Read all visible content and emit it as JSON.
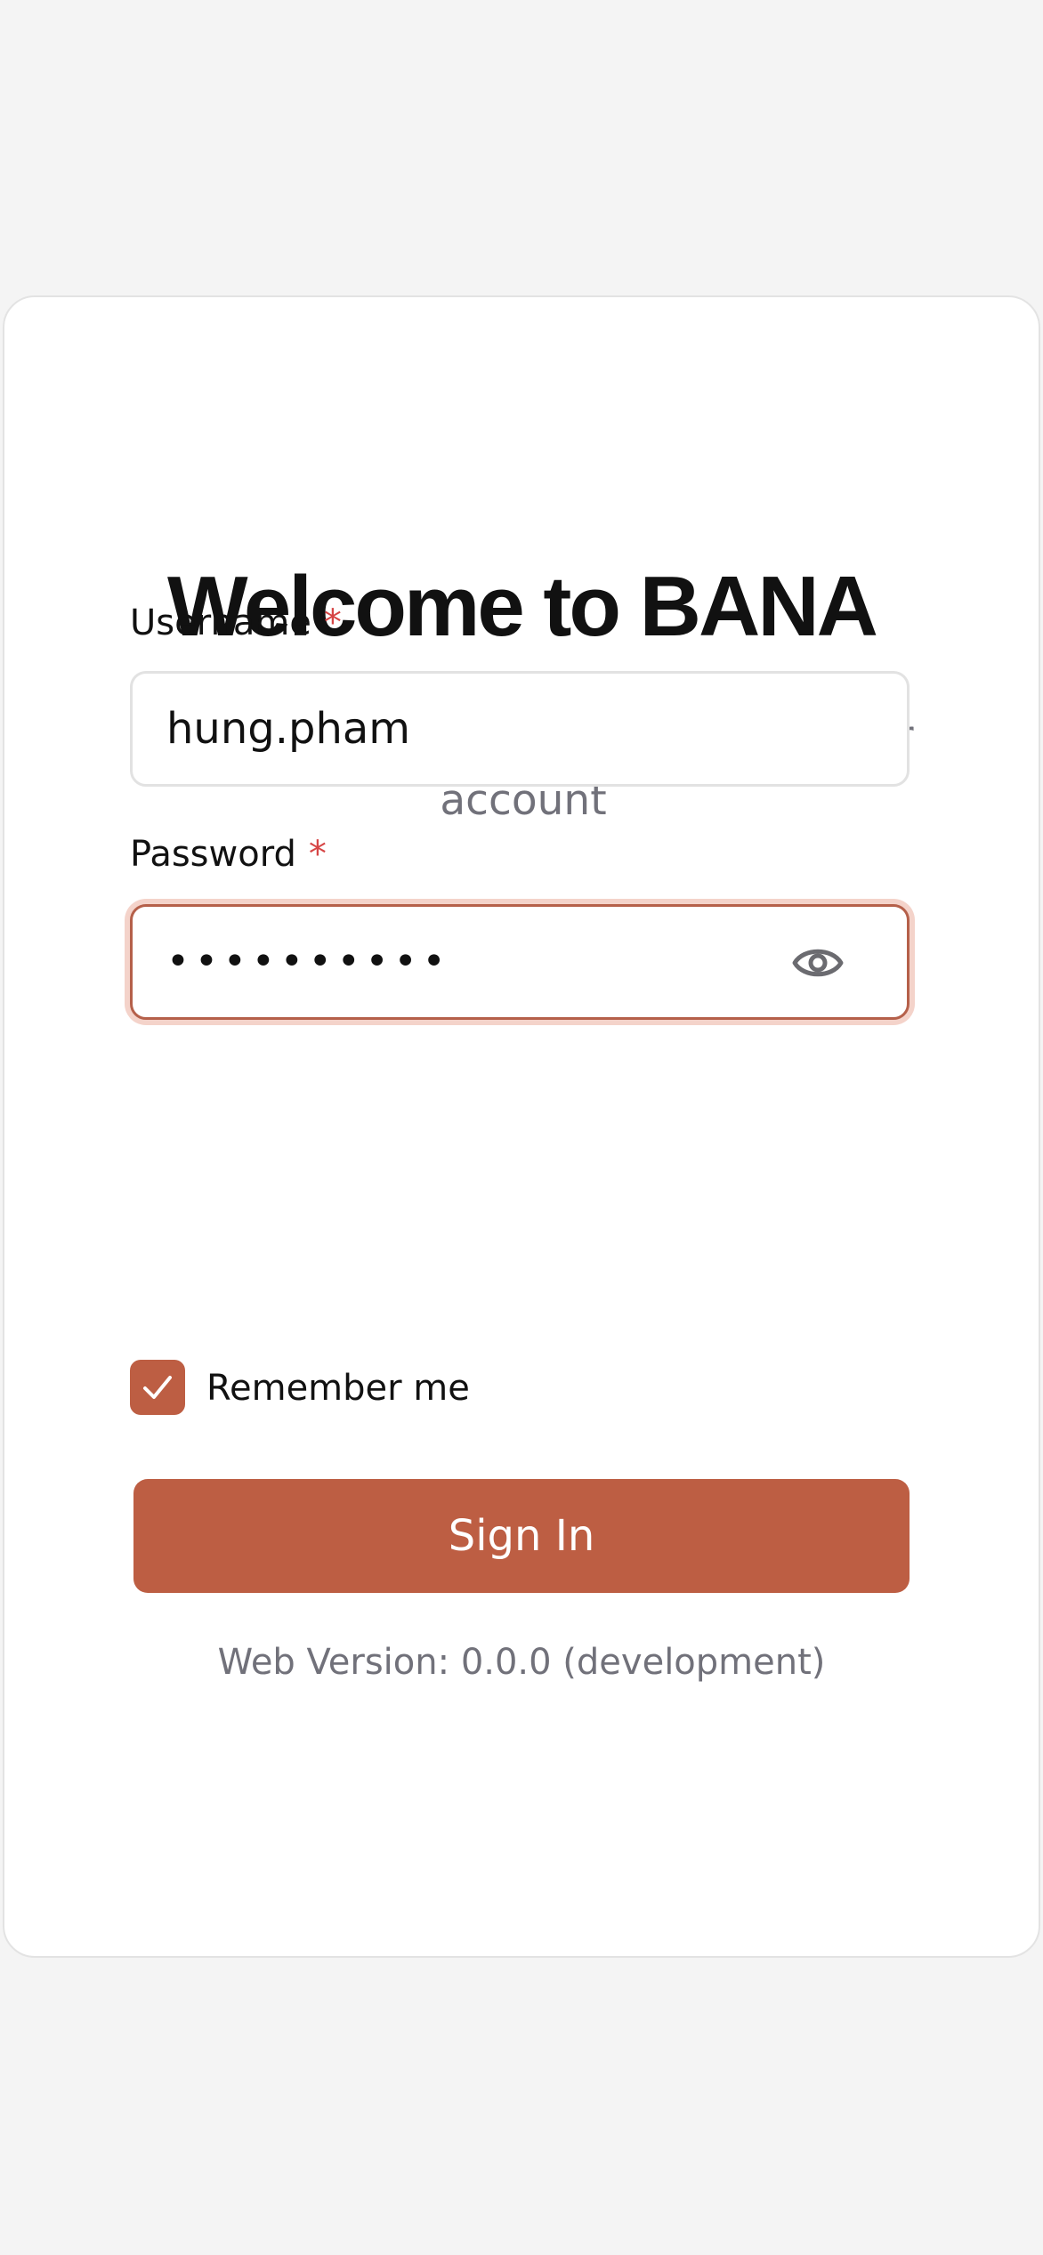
{
  "login": {
    "title": "Welcome to BANA",
    "subtitle": "Enter your credentials to access your account",
    "username": {
      "label": "Username",
      "required_marker": "*",
      "value": "hung.pham"
    },
    "password": {
      "label": "Password",
      "required_marker": "*",
      "masked_value": "••••••••••",
      "toggle_icon": "eye-icon"
    },
    "remember_me": {
      "label": "Remember me",
      "checked": true
    },
    "sign_in_label": "Sign In",
    "version_text": "Web Version: 0.0.0 (development)"
  },
  "colors": {
    "accent": "#bd5e43",
    "required": "#d64545",
    "muted_text": "#71717a",
    "background": "#f4f4f4"
  }
}
